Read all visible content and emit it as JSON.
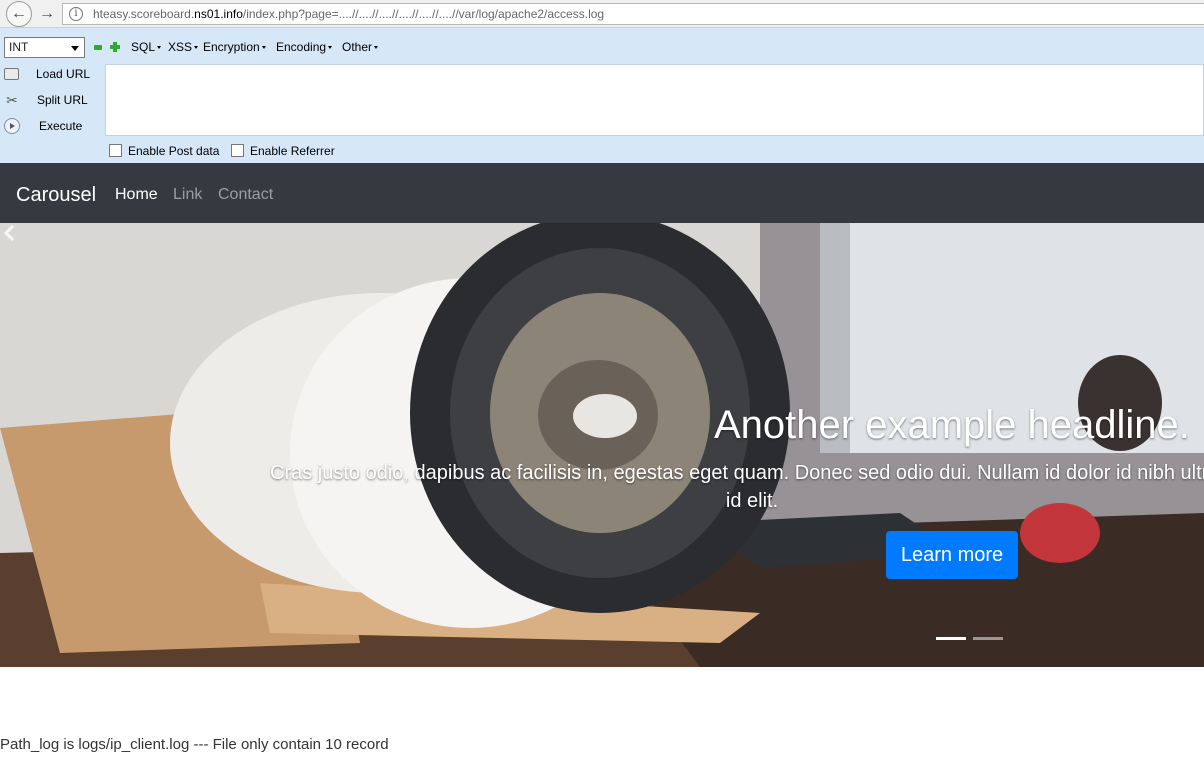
{
  "browser": {
    "url_host_pre": "hteasy.scoreboard.",
    "url_host": "ns01.info",
    "url_path": "/index.php?page=....//....//....//....//....//....//var/log/apache2/access.log",
    "info_icon": "info-icon",
    "back_icon": "arrow-left-icon",
    "forward_icon": "arrow-right-icon"
  },
  "hackbar": {
    "select_value": "INT",
    "menus": [
      "SQL",
      "XSS",
      "Encryption",
      "Encoding",
      "Other"
    ],
    "actions": [
      {
        "label": "Load URL",
        "icon": "load-url-icon"
      },
      {
        "label": "Split URL",
        "icon": "scissors-icon"
      },
      {
        "label": "Execute",
        "icon": "execute-icon"
      }
    ],
    "textarea_value": "",
    "checkboxes": [
      {
        "label": "Enable Post data",
        "checked": false
      },
      {
        "label": "Enable Referrer",
        "checked": false
      }
    ]
  },
  "site": {
    "brand": "Carousel",
    "nav": [
      {
        "label": "Home",
        "active": true
      },
      {
        "label": "Link",
        "active": false
      },
      {
        "label": "Contact",
        "active": false
      }
    ]
  },
  "carousel": {
    "heading": "Another example headline.",
    "text_line1": "Cras justo odio, dapibus ac facilisis in, egestas eget quam. Donec sed odio dui. Nullam id dolor id nibh ultricies vehicula ut id elit non mi porta gravida at eget metus.",
    "text_line2": "id elit.",
    "button_label": "Learn more",
    "active_index": 1,
    "indicator_count": 2,
    "prev_icon": "chevron-left-icon"
  },
  "page": {
    "path_log": "Path_log is logs/ip_client.log --- File only contain 10 record"
  }
}
